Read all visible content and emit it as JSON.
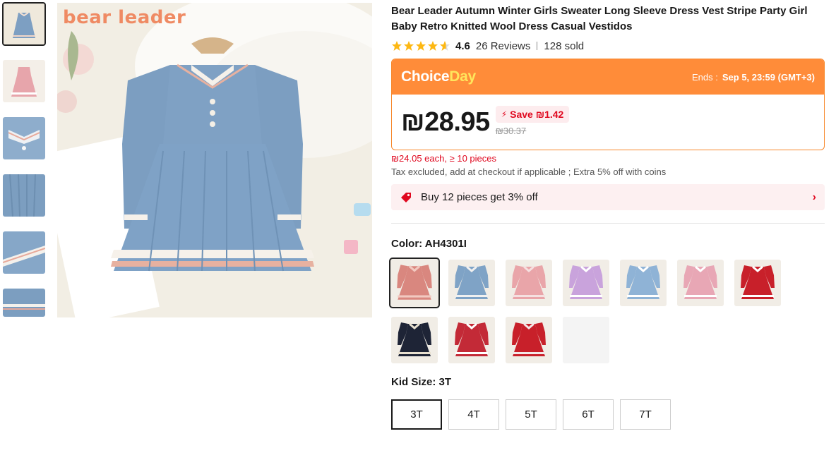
{
  "thumbnails": [
    {
      "name": "blue-dress-front",
      "active": true
    },
    {
      "name": "pink-dress"
    },
    {
      "name": "collar-detail"
    },
    {
      "name": "pleat-detail"
    },
    {
      "name": "sleeve-detail"
    },
    {
      "name": "hem-detail"
    }
  ],
  "main_image": {
    "brand_text": "bear leader"
  },
  "product": {
    "title": "Bear Leader Autumn Winter Girls Sweater Long Sleeve Dress Vest Stripe Party Girl Baby Retro Knitted Wool Dress Casual Vestidos",
    "rating": "4.6",
    "stars_filled": 4.6,
    "reviews": "26 Reviews",
    "sold": "128 sold"
  },
  "choice": {
    "logo_choice": "Choice",
    "logo_day": "Day",
    "ends_label": "Ends :",
    "ends_value": "Sep 5, 23:59 (GMT+3)",
    "price": "₪28.95",
    "save": "Save ₪1.42",
    "original_price": "₪30.37"
  },
  "bulk_price": "₪24.05 each, ≥ 10 pieces",
  "tax_note": "Tax excluded, add at checkout if applicable ; Extra 5% off with coins",
  "promo": {
    "text": "Buy 12 pieces get 3% off"
  },
  "color": {
    "label": "Color: AH4301I",
    "options": [
      {
        "name": "pink-floral",
        "main": "#d9877f",
        "accent": "#f2c9c0",
        "selected": true
      },
      {
        "name": "blue-vest",
        "main": "#7fa3c6",
        "accent": "#f0f0f0"
      },
      {
        "name": "pink-vest",
        "main": "#e9a5a9",
        "accent": "#f5e0e0"
      },
      {
        "name": "lilac",
        "main": "#c9a3dc",
        "accent": "#ffffff"
      },
      {
        "name": "light-blue",
        "main": "#8fb3d6",
        "accent": "#ffffff"
      },
      {
        "name": "pink-collar",
        "main": "#e8a7b5",
        "accent": "#ffffff"
      },
      {
        "name": "red-stripe",
        "main": "#c8202a",
        "accent": "#ffffff"
      },
      {
        "name": "black",
        "main": "#1e2436",
        "accent": "#e8e0d0"
      },
      {
        "name": "red-white",
        "main": "#c32a37",
        "accent": "#ffffff"
      },
      {
        "name": "red-bow",
        "main": "#c8202a",
        "accent": "#f3e8e8"
      },
      {
        "name": "empty",
        "main": "",
        "accent": ""
      }
    ]
  },
  "size": {
    "label": "Kid Size: 3T",
    "options": [
      "3T",
      "4T",
      "5T",
      "6T",
      "7T"
    ],
    "selected": "3T"
  }
}
